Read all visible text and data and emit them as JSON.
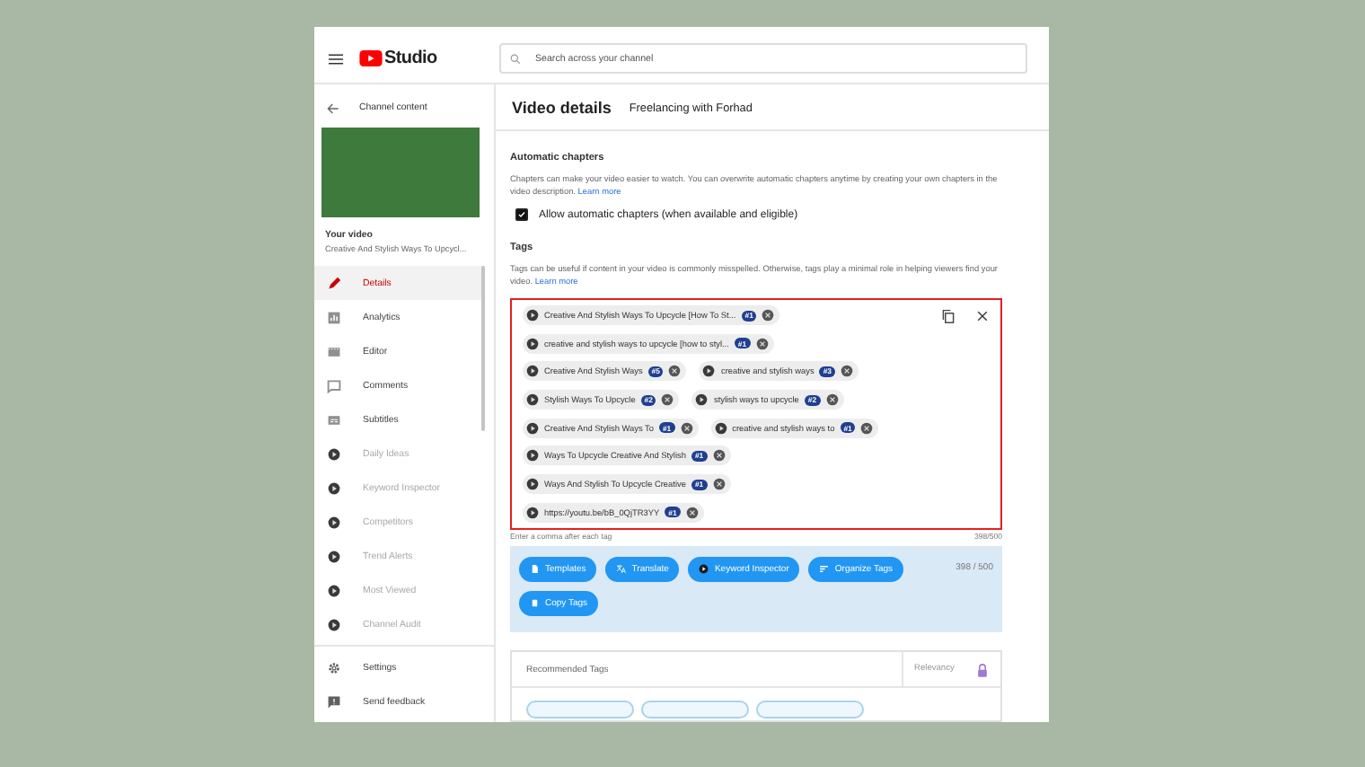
{
  "header": {
    "brand": "Studio",
    "search_placeholder": "Search across your channel"
  },
  "sidebar": {
    "back_label": "Channel content",
    "video_label": "Your video",
    "video_title": "Creative And Stylish Ways To Upcycl...",
    "items": [
      {
        "label": "Details",
        "kind": "pencil",
        "selected": true,
        "disabled": false
      },
      {
        "label": "Analytics",
        "kind": "chart",
        "selected": false,
        "disabled": false
      },
      {
        "label": "Editor",
        "kind": "film",
        "selected": false,
        "disabled": false
      },
      {
        "label": "Comments",
        "kind": "comment",
        "selected": false,
        "disabled": false
      },
      {
        "label": "Subtitles",
        "kind": "subtitles",
        "selected": false,
        "disabled": false
      },
      {
        "label": "Daily Ideas",
        "kind": "extension",
        "selected": false,
        "disabled": true
      },
      {
        "label": "Keyword Inspector",
        "kind": "extension",
        "selected": false,
        "disabled": true
      },
      {
        "label": "Competitors",
        "kind": "extension",
        "selected": false,
        "disabled": true
      },
      {
        "label": "Trend Alerts",
        "kind": "extension",
        "selected": false,
        "disabled": true
      },
      {
        "label": "Most Viewed",
        "kind": "extension",
        "selected": false,
        "disabled": true
      },
      {
        "label": "Channel Audit",
        "kind": "extension",
        "selected": false,
        "disabled": true
      }
    ],
    "footer": [
      {
        "label": "Settings",
        "kind": "gear"
      },
      {
        "label": "Send feedback",
        "kind": "feedback"
      }
    ]
  },
  "main": {
    "title": "Video details",
    "channel": "Freelancing with Forhad",
    "chapters": {
      "heading": "Automatic chapters",
      "description": "Chapters can make your video easier to watch. You can overwrite automatic chapters anytime by creating your own chapters in the video description.",
      "link": "Learn more",
      "checkbox": {
        "label": "Allow automatic chapters (when available and eligible)",
        "checked": true
      }
    },
    "tags": {
      "heading": "Tags",
      "description": "Tags can be useful if content in your video is commonly misspelled. Otherwise, tags play a minimal role in helping viewers find your video.",
      "link": "Learn more",
      "rows": [
        [
          {
            "text": "Creative And Stylish Ways To Upcycle [How To St...",
            "rank": "#1"
          }
        ],
        [
          {
            "text": "creative and stylish ways to upcycle [how to styl...",
            "rank": "#1"
          }
        ],
        [
          {
            "text": "Creative And Stylish Ways",
            "rank": "#5"
          },
          {
            "text": "creative and stylish ways",
            "rank": "#3"
          }
        ],
        [
          {
            "text": "Stylish Ways To Upcycle",
            "rank": "#2"
          },
          {
            "text": "stylish ways to upcycle",
            "rank": "#2"
          }
        ],
        [
          {
            "text": "Creative And Stylish Ways To",
            "rank": "#1"
          },
          {
            "text": "creative and stylish ways to",
            "rank": "#1"
          }
        ],
        [
          {
            "text": "Ways To Upcycle Creative And Stylish",
            "rank": "#1"
          }
        ],
        [
          {
            "text": "Ways And Stylish To Upcycle Creative",
            "rank": "#1"
          }
        ],
        [
          {
            "text": "https://youtu.be/bB_0QjTR3YY",
            "rank": "#1"
          }
        ]
      ],
      "hint": "Enter a comma after each tag",
      "count": "398/500"
    },
    "toolbar": {
      "buttons": [
        {
          "label": "Templates",
          "kind": "doc"
        },
        {
          "label": "Translate",
          "kind": "translate"
        },
        {
          "label": "Keyword Inspector",
          "kind": "extension"
        },
        {
          "label": "Organize Tags",
          "kind": "sort"
        },
        {
          "label": "Copy Tags",
          "kind": "copy"
        }
      ],
      "count": "398 / 500"
    },
    "recommended": {
      "heading": "Recommended Tags",
      "relevancy": "Relevancy"
    }
  }
}
